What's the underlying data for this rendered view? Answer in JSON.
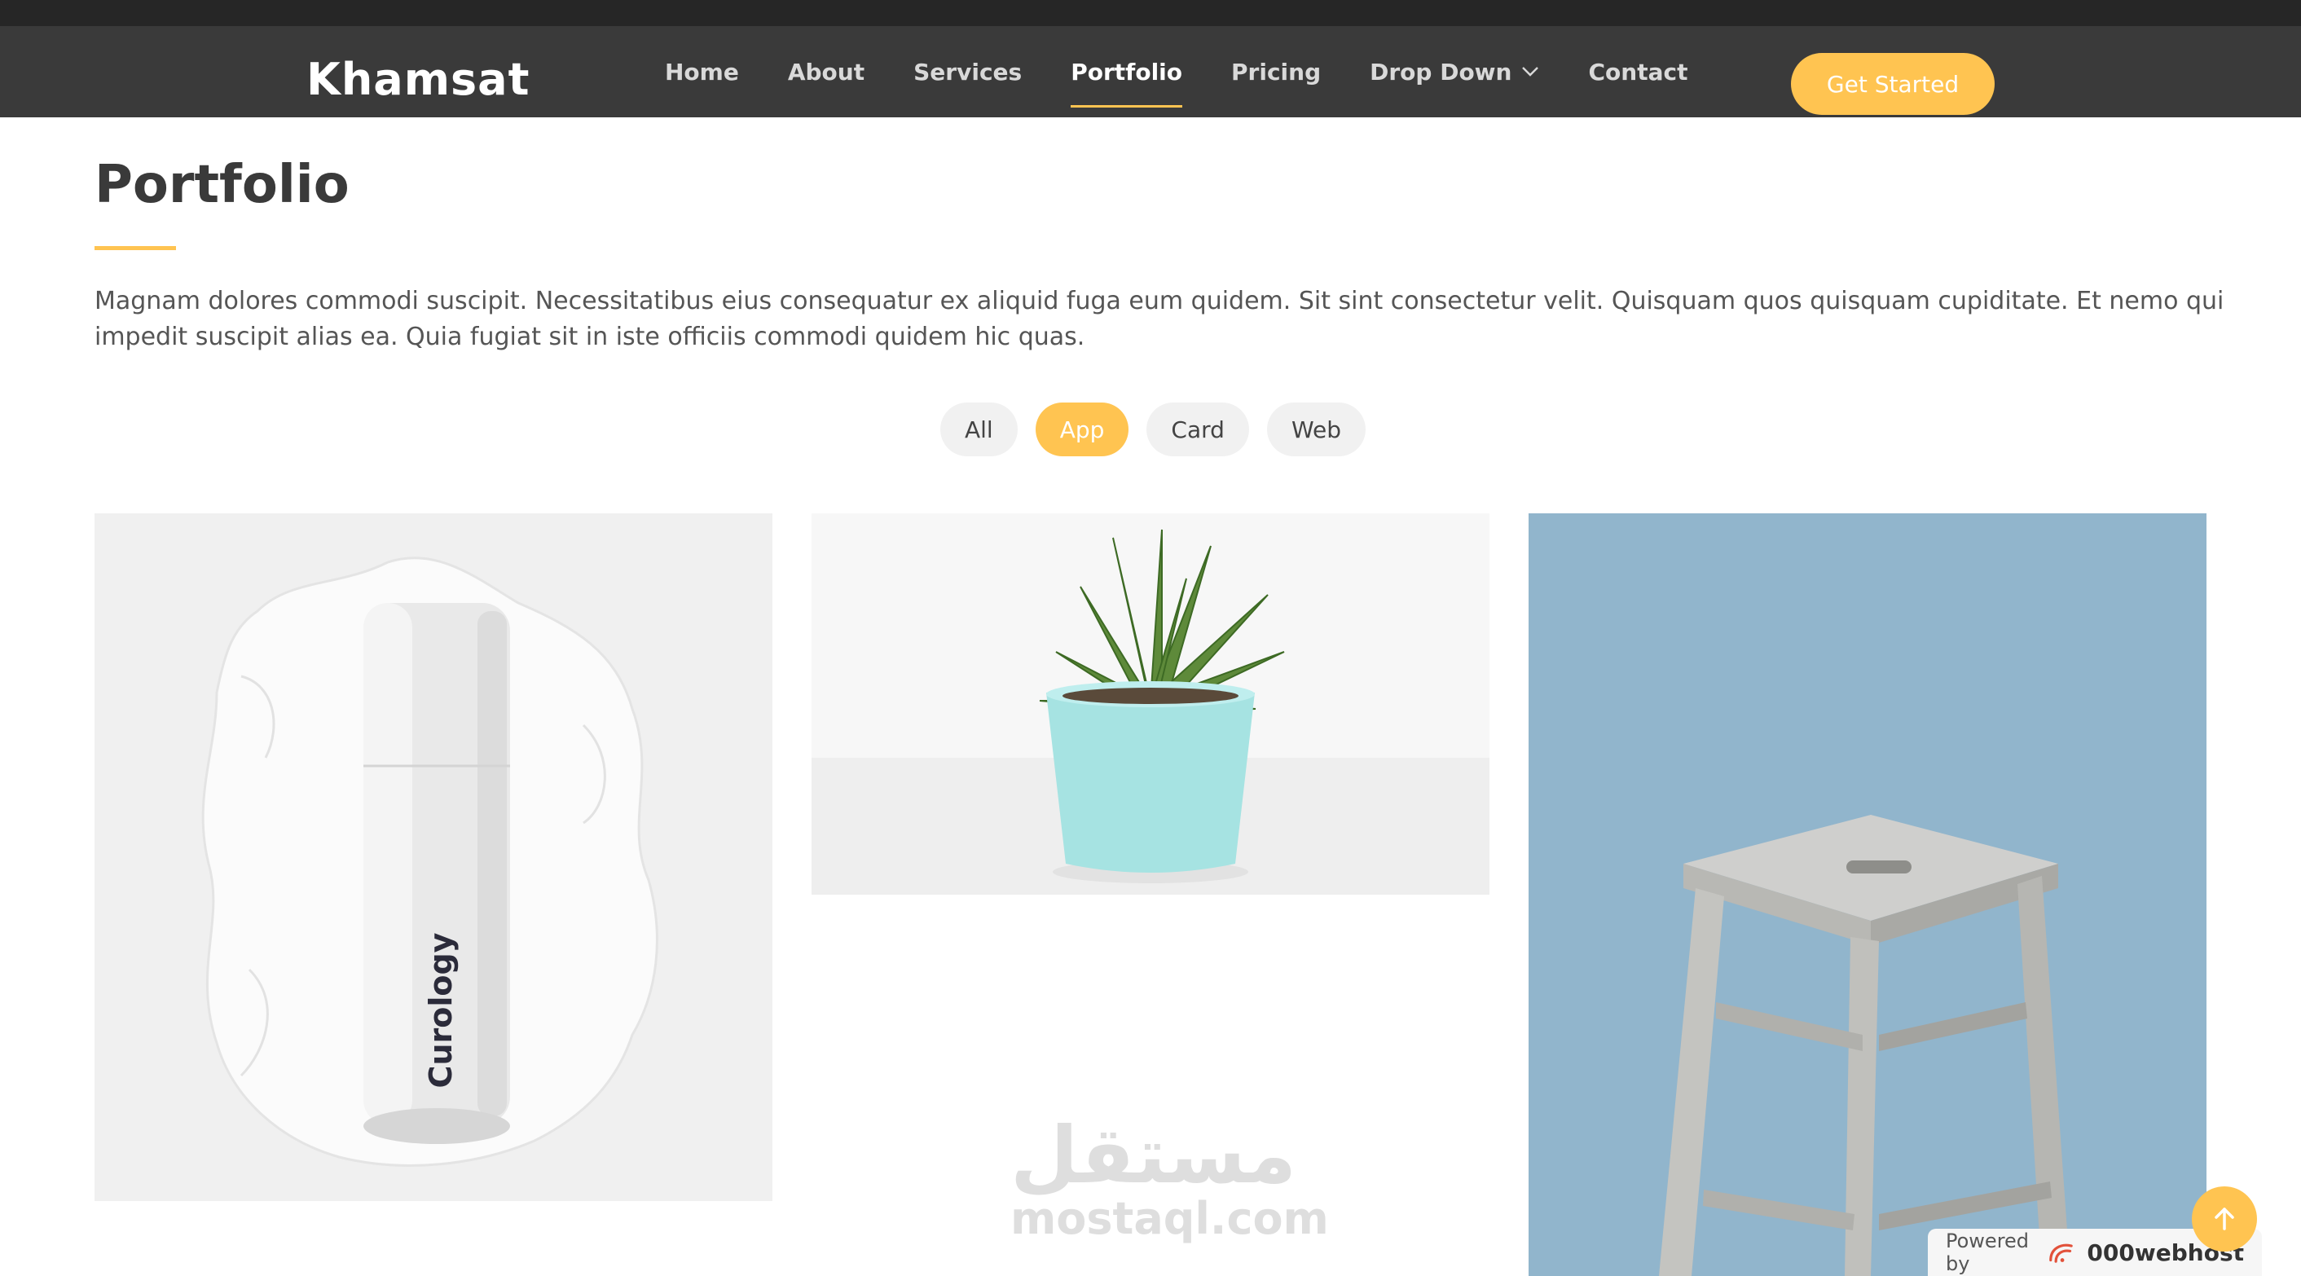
{
  "header": {
    "logo": "Khamsat",
    "nav": [
      {
        "label": "Home"
      },
      {
        "label": "About"
      },
      {
        "label": "Services"
      },
      {
        "label": "Portfolio",
        "active": true
      },
      {
        "label": "Pricing"
      },
      {
        "label": "Drop Down",
        "has_dropdown": true
      },
      {
        "label": "Contact"
      }
    ],
    "cta_label": "Get Started"
  },
  "portfolio": {
    "title": "Portfolio",
    "intro": "Magnam dolores commodi suscipit. Necessitatibus eius consequatur ex aliquid fuga eum quidem. Sit sint consectetur velit. Quisquam quos quisquam cupiditate. Et nemo qui impedit suscipit alias ea. Quia fugiat sit in iste officiis commodi quidem hic quas.",
    "filters": [
      {
        "label": "All",
        "active": false
      },
      {
        "label": "App",
        "active": true
      },
      {
        "label": "Card",
        "active": false
      },
      {
        "label": "Web",
        "active": false
      }
    ],
    "items": [
      {
        "subject": "cosmetic bottle",
        "product_text": "Curology"
      },
      {
        "subject": "potted succulent plant"
      },
      {
        "subject": "wooden stool"
      }
    ]
  },
  "watermark": {
    "arabic": "مستقل",
    "latin": "mostaql.com"
  },
  "powered": {
    "prefix": "Powered by",
    "brand": "000webhost"
  },
  "colors": {
    "accent": "#ffc451",
    "header_bg": "#3a3a3a",
    "top_strip": "#262626",
    "stool_bg": "#91b5cc"
  },
  "icons": {
    "dropdown": "chevron-down-icon",
    "back_to_top": "arrow-up-icon",
    "host_logo": "swirl-icon"
  }
}
